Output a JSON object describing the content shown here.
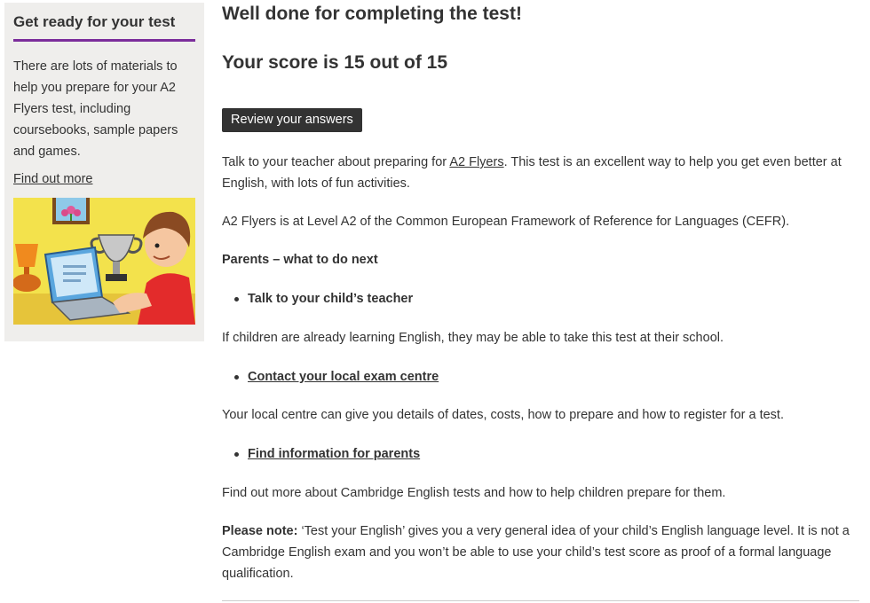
{
  "sidebar": {
    "title": "Get ready for your test",
    "text": "There are lots of materials to help you prepare for your A2 Flyers test, including coursebooks, sample papers and games.",
    "link": "Find out more",
    "illustration_icon": "boy-with-laptop-illustration"
  },
  "main": {
    "heading": "Well done for completing the test!",
    "score": "Your score is 15 out of 15",
    "review_button": "Review your answers",
    "intro_before": "Talk to your teacher about preparing for ",
    "intro_link": "A2 Flyers",
    "intro_after": ". This test is an excellent way to help you get even better at English, with lots of fun activities.",
    "level_text": "A2 Flyers is at Level A2 of the Common European Framework of Reference for Languages (CEFR).",
    "parents_heading": "Parents – what to do next",
    "bullet1": "Talk to your child’s teacher",
    "bullet1_text": "If children are already learning English, they may be able to take this test at their school.",
    "bullet2": "Contact your local exam centre",
    "bullet2_text": "Your local centre can give you details of dates, costs, how to prepare and how to register for a test.",
    "bullet3": "Find information for parents",
    "bullet3_text": "Find out more about Cambridge English tests and how to help children prepare for them.",
    "note_label": "Please note:",
    "note_text": " ‘Test your English’ gives you a very general idea of your child’s English language level. It is not a Cambridge English exam and you won’t be able to use your child’s test score as proof of a formal language qualification."
  },
  "colors": {
    "accent": "#7b2d9b",
    "button_bg": "#333333",
    "sidebar_bg": "#efeeec"
  }
}
